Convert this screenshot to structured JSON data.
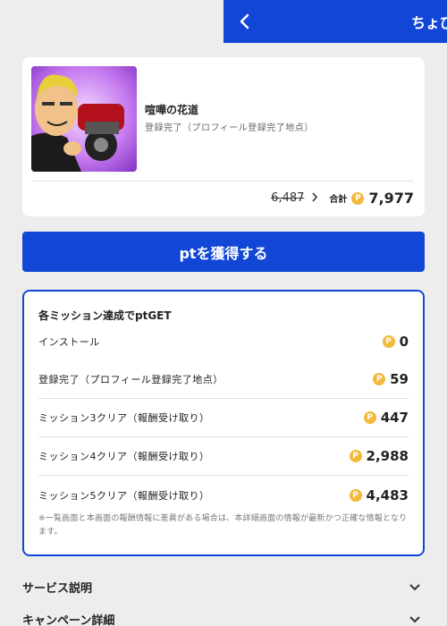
{
  "header": {
    "title": "ちょび",
    "back_icon": "chevron-left-icon"
  },
  "app_card": {
    "name": "喧嘩の花道",
    "condition": "登録完了（プロフィール登録完了地点）",
    "old_points": "6,487",
    "total_label": "合計",
    "total_points": "7,977",
    "coin_glyph": "P"
  },
  "cta": {
    "label": "ptを獲得する"
  },
  "missions": {
    "title": "各ミッション達成でptGET",
    "items": [
      {
        "label": "インストール",
        "points": "0"
      },
      {
        "label": "登録完了（プロフィール登録完了地点）",
        "points": "59"
      },
      {
        "label": "ミッション3クリア（報酬受け取り）",
        "points": "447"
      },
      {
        "label": "ミッション4クリア（報酬受け取り）",
        "points": "2,988"
      },
      {
        "label": "ミッション5クリア（報酬受け取り）",
        "points": "4,483"
      }
    ],
    "note": "※一覧画面と本画面の報酬情報に差異がある場合は、本詳細画面の情報が最新かつ正確な情報となります。"
  },
  "accordions": [
    {
      "label": "サービス説明"
    },
    {
      "label": "キャンペーン詳細"
    }
  ],
  "colors": {
    "brand_blue": "#1246d6",
    "coin_gold": "#f2b93b",
    "background": "#ededed"
  }
}
